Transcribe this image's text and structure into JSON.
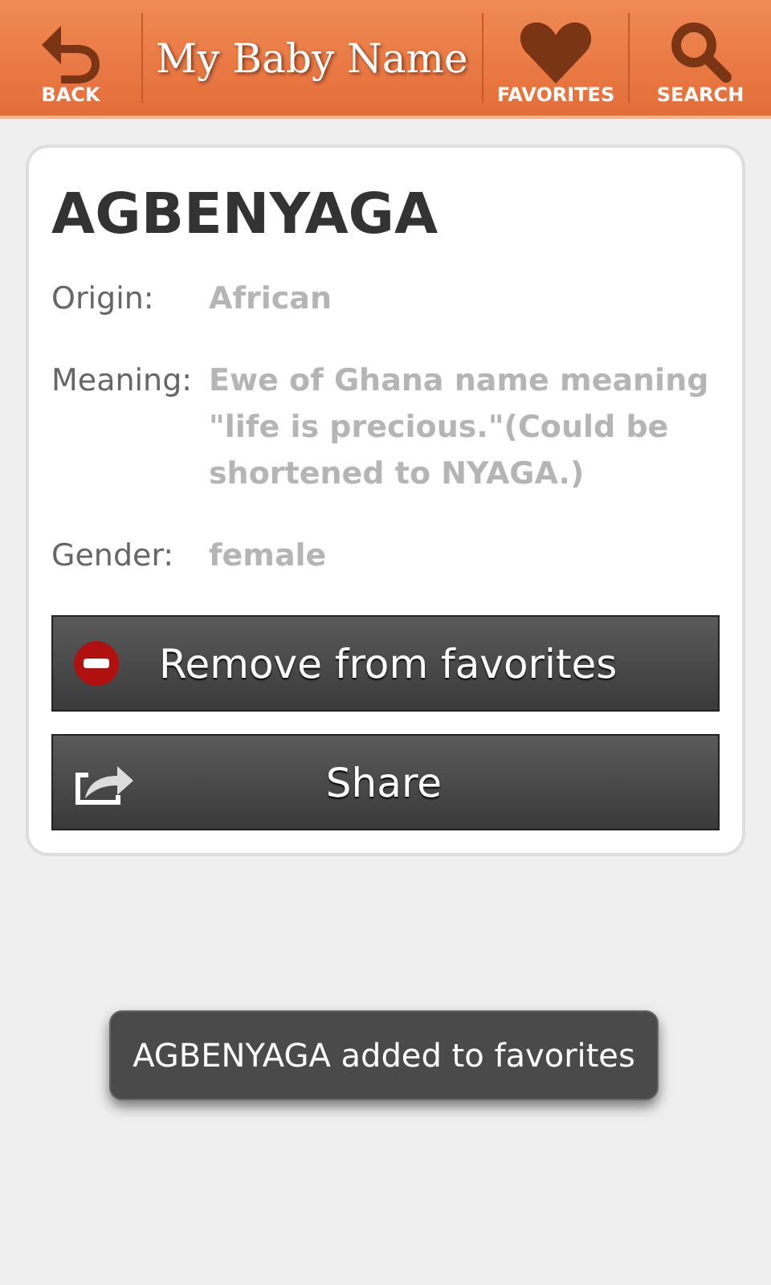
{
  "toolbar": {
    "back": "BACK",
    "title": "My Baby Name",
    "favorites": "FAVORITES",
    "search": "SEARCH"
  },
  "name": "AGBENYAGA",
  "fields": [
    {
      "label": "Origin:",
      "value": "African"
    },
    {
      "label": "Meaning:",
      "value": "Ewe of Ghana name meaning \"life is precious.\"(Could be shortened to NYAGA.)"
    },
    {
      "label": "Gender:",
      "value": "female"
    }
  ],
  "actions": [
    {
      "kind": "remove",
      "label": "Remove from favorites"
    },
    {
      "kind": "share",
      "label": "Share"
    }
  ],
  "toast": "AGBENYAGA added to favorites"
}
